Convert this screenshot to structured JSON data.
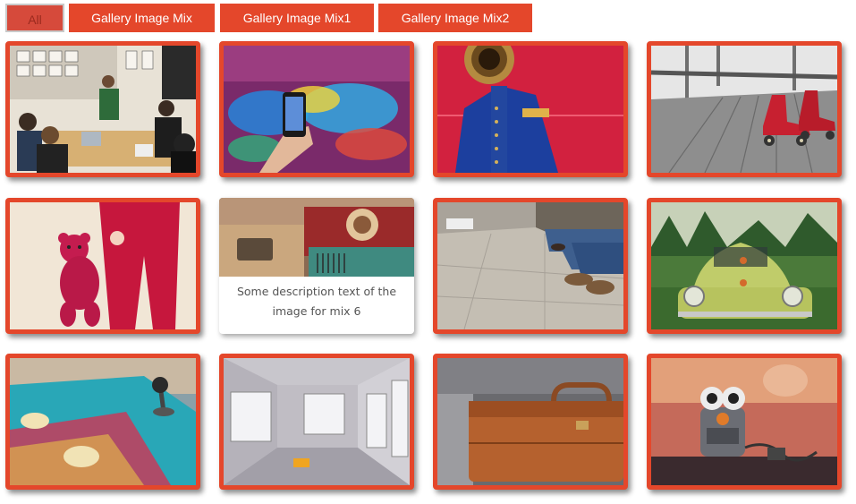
{
  "filters": [
    {
      "label": "All",
      "active": true
    },
    {
      "label": "Gallery Image Mix",
      "active": false
    },
    {
      "label": "Gallery Image Mix1",
      "active": false
    },
    {
      "label": "Gallery Image Mix2",
      "active": false
    }
  ],
  "gallery": {
    "items": [
      {
        "subject": "office meeting"
      },
      {
        "subject": "phone graffiti"
      },
      {
        "subject": "trumpet player"
      },
      {
        "subject": "roller skates"
      },
      {
        "subject": "teddy bear"
      },
      {
        "subject": "vintage radio",
        "caption": "Some description text of the image for mix 6"
      },
      {
        "subject": "street sitting"
      },
      {
        "subject": "green beetle car"
      },
      {
        "subject": "arcade controls"
      },
      {
        "subject": "empty room"
      },
      {
        "subject": "old suitcase"
      },
      {
        "subject": "robot toy"
      }
    ]
  },
  "colors": {
    "accent": "#e4472b",
    "active_filter": "#d64a3b"
  }
}
